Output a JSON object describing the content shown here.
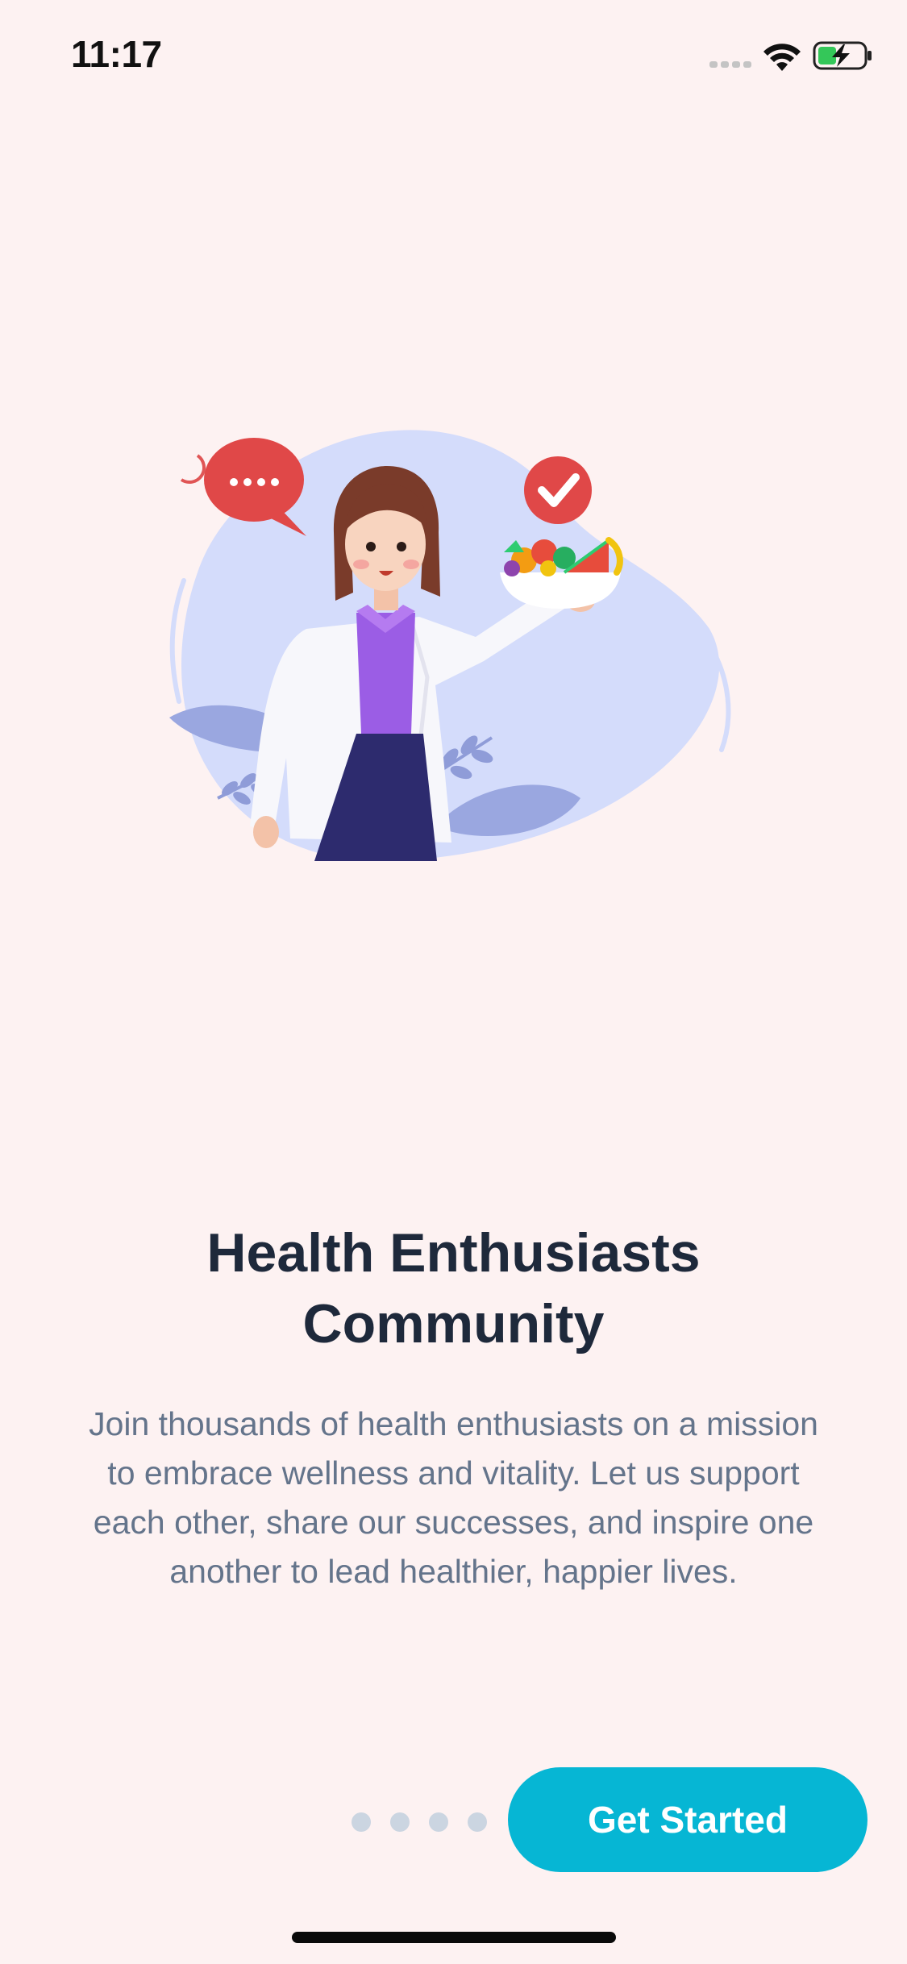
{
  "status_bar": {
    "time": "11:17",
    "icons": [
      "cellular-signal-icon",
      "wifi-icon",
      "battery-charging-icon"
    ]
  },
  "illustration": {
    "description_icon": "doctor-with-fruit-bowl-illustration",
    "icons": [
      "speech-bubble-icon",
      "checkmark-icon",
      "fruit-bowl-icon"
    ]
  },
  "onboarding": {
    "title": "Health Enthusiasts Community",
    "description": "Join thousands of health enthusiasts on a mission to embrace wellness and vitality. Let us support each other, share our successes, and inspire one another to lead healthier, happier lives."
  },
  "pagination": {
    "total_pages": 4
  },
  "actions": {
    "primary_label": "Get Started"
  },
  "colors": {
    "background": "#fdf2f2",
    "primary": "#06b6d4",
    "title": "#1e293b",
    "body": "#64748b",
    "dot": "#cbd5e1"
  }
}
